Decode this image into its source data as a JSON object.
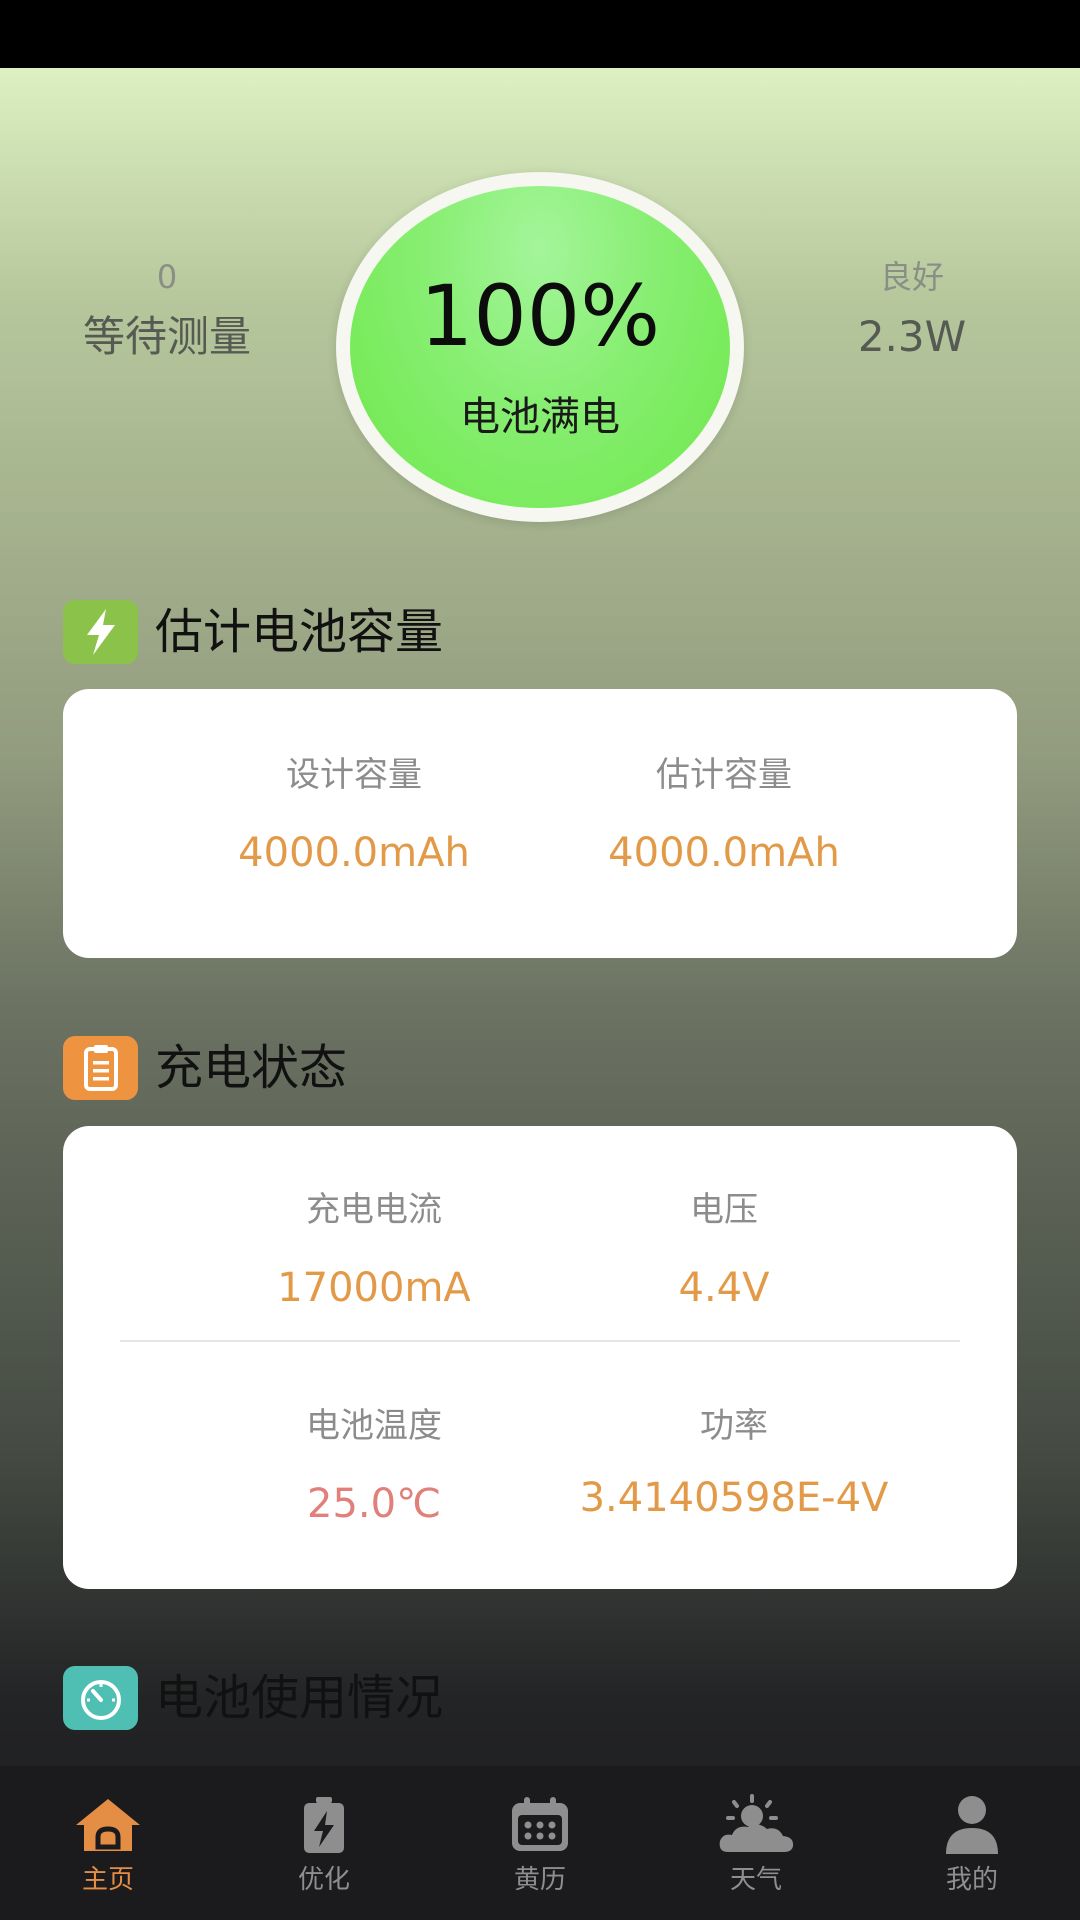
{
  "top": {
    "left_small": "0",
    "left_big": "等待测量",
    "gauge_value": "100%",
    "gauge_label": "电池满电",
    "right_small": "良好",
    "right_big": "2.3W"
  },
  "capacity_section": {
    "title": "估计电池容量",
    "icon": "lightning-icon",
    "design_label": "设计容量",
    "design_value": "4000.0mAh",
    "estimated_label": "估计容量",
    "estimated_value": "4000.0mAh"
  },
  "charge_section": {
    "title": "充电状态",
    "icon": "clipboard-icon",
    "current_label": "充电电流",
    "current_value": "17000mA",
    "voltage_label": "电压",
    "voltage_value": "4.4V",
    "temp_label": "电池温度",
    "temp_value": "25.0℃",
    "power_label": "功率",
    "power_value": "3.4140598E-4V"
  },
  "usage_section": {
    "title": "电池使用情况",
    "icon": "speedometer-icon"
  },
  "nav": {
    "items": [
      {
        "label": "主页",
        "icon": "home-icon",
        "active": true
      },
      {
        "label": "优化",
        "icon": "battery-bolt-icon"
      },
      {
        "label": "黄历",
        "icon": "calendar-icon"
      },
      {
        "label": "天气",
        "icon": "weather-icon"
      },
      {
        "label": "我的",
        "icon": "user-icon"
      }
    ]
  },
  "colors": {
    "accent": "#e48e45",
    "value_orange": "#e39a48",
    "value_red": "#e1807a",
    "gauge_green": "#7eeb62",
    "icon_green": "#8bc34a",
    "icon_orange": "#ee9440",
    "icon_teal": "#4fbfb3"
  }
}
